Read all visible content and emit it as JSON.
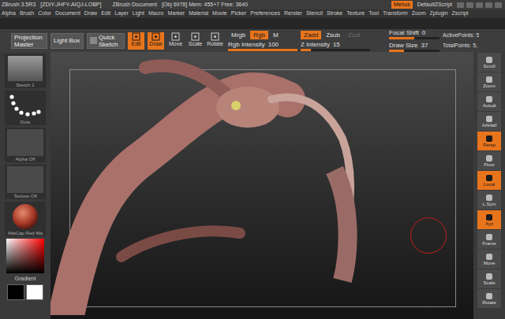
{
  "title_bar": {
    "app": "ZBrush 3.5R3",
    "code": "[ZDIY-JHFY-AIQJ-LOBP]",
    "document": "ZBrush Document",
    "stats": "[Obj 6978] Mem: 455+7 Free: 3640",
    "menus_button": "Menus",
    "script": "DefaultZScript"
  },
  "menus": [
    "Alpha",
    "Brush",
    "Color",
    "Document",
    "Draw",
    "Edit",
    "Layer",
    "Light",
    "Macro",
    "Marker",
    "Material",
    "Movie",
    "Picker",
    "Preferences",
    "Render",
    "Stencil",
    "Stroke",
    "Texture",
    "Tool",
    "Transform",
    "Zoom",
    "Zplugin",
    "Zscript"
  ],
  "shelf_buttons": [
    "Projection Master",
    "Light Box",
    "Quick Sketch"
  ],
  "transform_buttons": [
    {
      "label": "Edit",
      "selected": true
    },
    {
      "label": "Draw",
      "selected": true
    },
    {
      "label": "Move",
      "selected": false
    },
    {
      "label": "Scale",
      "selected": false
    },
    {
      "label": "Rotate",
      "selected": false
    }
  ],
  "color_modes": [
    {
      "label": "Mrgb",
      "selected": false
    },
    {
      "label": "Rgb",
      "selected": true
    },
    {
      "label": "M",
      "selected": false
    }
  ],
  "z_modes": [
    {
      "label": "Zadd",
      "selected": true,
      "disabled": false
    },
    {
      "label": "Zsub",
      "selected": false,
      "disabled": false
    },
    {
      "label": "Zcut",
      "selected": false,
      "disabled": true
    }
  ],
  "sliders": {
    "rgb_intensity": {
      "label": "Rgb Intensity",
      "value": "100",
      "level": 1.0
    },
    "z_intensity": {
      "label": "Z Intensity",
      "value": "15",
      "level": 0.15
    },
    "focal_shift": {
      "label": "Focal Shift",
      "value": "0",
      "level": 0.5
    },
    "draw_size": {
      "label": "Draw Size",
      "value": "37",
      "level": 0.3
    }
  },
  "stats": [
    "ActivePoints: 5",
    "TotalPoints: 5,"
  ],
  "left_shelf": [
    {
      "label": "Sketch 1",
      "kind": "sketch"
    },
    {
      "label": "Dots",
      "kind": "dots"
    },
    {
      "label": "Alpha Off",
      "kind": "empty"
    },
    {
      "label": "Texture Off",
      "kind": "empty"
    },
    {
      "label": "MatCap Red Wa",
      "kind": "material"
    }
  ],
  "gradient": {
    "label": "Gradient",
    "main_color": "#000000",
    "secondary_color": "#ffffff"
  },
  "right_shelf": [
    {
      "label": "Scroll",
      "selected": false
    },
    {
      "label": "Zoom",
      "selected": false
    },
    {
      "label": "Actual",
      "selected": false
    },
    {
      "label": "AAHalf",
      "selected": false
    },
    {
      "label": "Persp",
      "selected": true
    },
    {
      "label": "Floor",
      "selected": false
    },
    {
      "label": "Local",
      "selected": true
    },
    {
      "label": "L.Sym",
      "selected": false
    },
    {
      "label": "Xyz",
      "selected": true
    },
    {
      "label": "Frame",
      "selected": false
    },
    {
      "label": "Move",
      "selected": false
    },
    {
      "label": "Scale",
      "selected": false
    },
    {
      "label": "Rotate",
      "selected": false
    }
  ]
}
